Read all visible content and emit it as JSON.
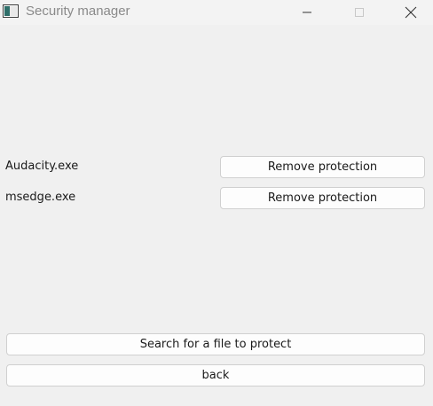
{
  "window": {
    "title": "Security manager",
    "controls": [
      "minimize-icon",
      "maximize-icon",
      "close-icon"
    ]
  },
  "protected_files": [
    {
      "name": "Audacity.exe",
      "action_label": "Remove protection"
    },
    {
      "name": "msedge.exe",
      "action_label": "Remove protection"
    }
  ],
  "actions": {
    "search_label": "Search for a file to protect",
    "back_label": "back"
  },
  "colors": {
    "background": "#f0f0f0",
    "button_background": "#fdfdfd",
    "button_border": "#d0d0d0",
    "title_text": "#8a8a8a"
  }
}
